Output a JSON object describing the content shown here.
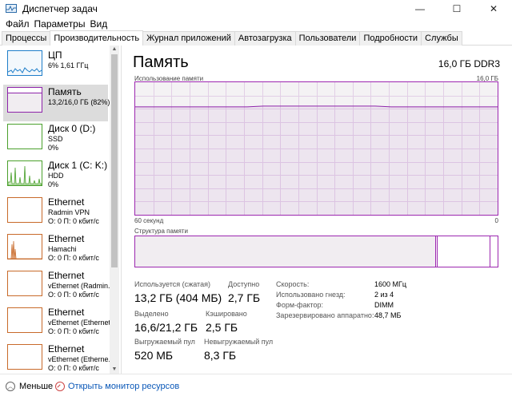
{
  "window": {
    "title": "Диспетчер задач",
    "controls": {
      "minimize": "—",
      "maximize": "☐",
      "close": "✕"
    }
  },
  "menu": [
    "Файл",
    "Параметры",
    "Вид"
  ],
  "tabs": [
    {
      "label": "Процессы",
      "active": false
    },
    {
      "label": "Производительность",
      "active": true
    },
    {
      "label": "Журнал приложений",
      "active": false
    },
    {
      "label": "Автозагрузка",
      "active": false
    },
    {
      "label": "Пользователи",
      "active": false
    },
    {
      "label": "Подробности",
      "active": false
    },
    {
      "label": "Службы",
      "active": false
    }
  ],
  "sidebar": {
    "items": [
      {
        "title": "ЦП",
        "sub": "6%  1,61 ГГц",
        "sub2": "",
        "color": "#1f7ec9"
      },
      {
        "title": "Память",
        "sub": "13,2/16,0 ГБ (82%)",
        "sub2": "",
        "color": "#8e24aa"
      },
      {
        "title": "Диск 0 (D:)",
        "sub": "SSD",
        "sub2": "0%",
        "color": "#4aa02c"
      },
      {
        "title": "Диск 1 (C: K:)",
        "sub": "HDD",
        "sub2": "0%",
        "color": "#4aa02c"
      },
      {
        "title": "Ethernet",
        "sub": "Radmin VPN",
        "sub2": "О: 0 П: 0 кбит/с",
        "color": "#c86a2a"
      },
      {
        "title": "Ethernet",
        "sub": "Hamachi",
        "sub2": "О: 0 П: 0 кбит/с",
        "color": "#c86a2a"
      },
      {
        "title": "Ethernet",
        "sub": "vEthernet (Radmin...",
        "sub2": "О: 0 П: 0 кбит/с",
        "color": "#c86a2a"
      },
      {
        "title": "Ethernet",
        "sub": "vEthernet (Ethernet)",
        "sub2": "О: 0 П: 0 кбит/с",
        "color": "#c86a2a"
      },
      {
        "title": "Ethernet",
        "sub": "vEthernet (Etherne...",
        "sub2": "О: 0 П: 0 кбит/с",
        "color": "#c86a2a"
      }
    ],
    "selected_index": 1
  },
  "main": {
    "title": "Память",
    "meta": "16,0 ГБ DDR3",
    "graph_label": "Использование памяти",
    "graph_max": "16,0 ГБ",
    "graph_time": "60 секунд",
    "graph_zero": "0",
    "usage_level": 0.82,
    "structure_label": "Структура памяти",
    "stats": {
      "in_use_label": "Используется (сжатая)",
      "in_use_value": "13,2 ГБ (404 МБ)",
      "available_label": "Доступно",
      "available_value": "2,7 ГБ",
      "committed_label": "Выделено",
      "committed_value": "16,6/21,2 ГБ",
      "cached_label": "Кэшировано",
      "cached_value": "2,5 ГБ",
      "paged_label": "Выгружаемый пул",
      "paged_value": "520 МБ",
      "nonpaged_label": "Невыгружаемый пул",
      "nonpaged_value": "8,3 ГБ"
    },
    "details": [
      {
        "label": "Скорость:",
        "value": "1600 МГц"
      },
      {
        "label": "Использовано гнезд:",
        "value": "2 из 4"
      },
      {
        "label": "Форм-фактор:",
        "value": "DIMM"
      },
      {
        "label": "Зарезервировано аппаратно:",
        "value": "48,7 МБ"
      }
    ]
  },
  "bottom": {
    "fewer": "Меньше",
    "monitor": "Открыть монитор ресурсов"
  },
  "colors": {
    "memory": "#8e24aa",
    "cpu": "#1f7ec9",
    "disk": "#4aa02c",
    "net": "#c86a2a"
  }
}
